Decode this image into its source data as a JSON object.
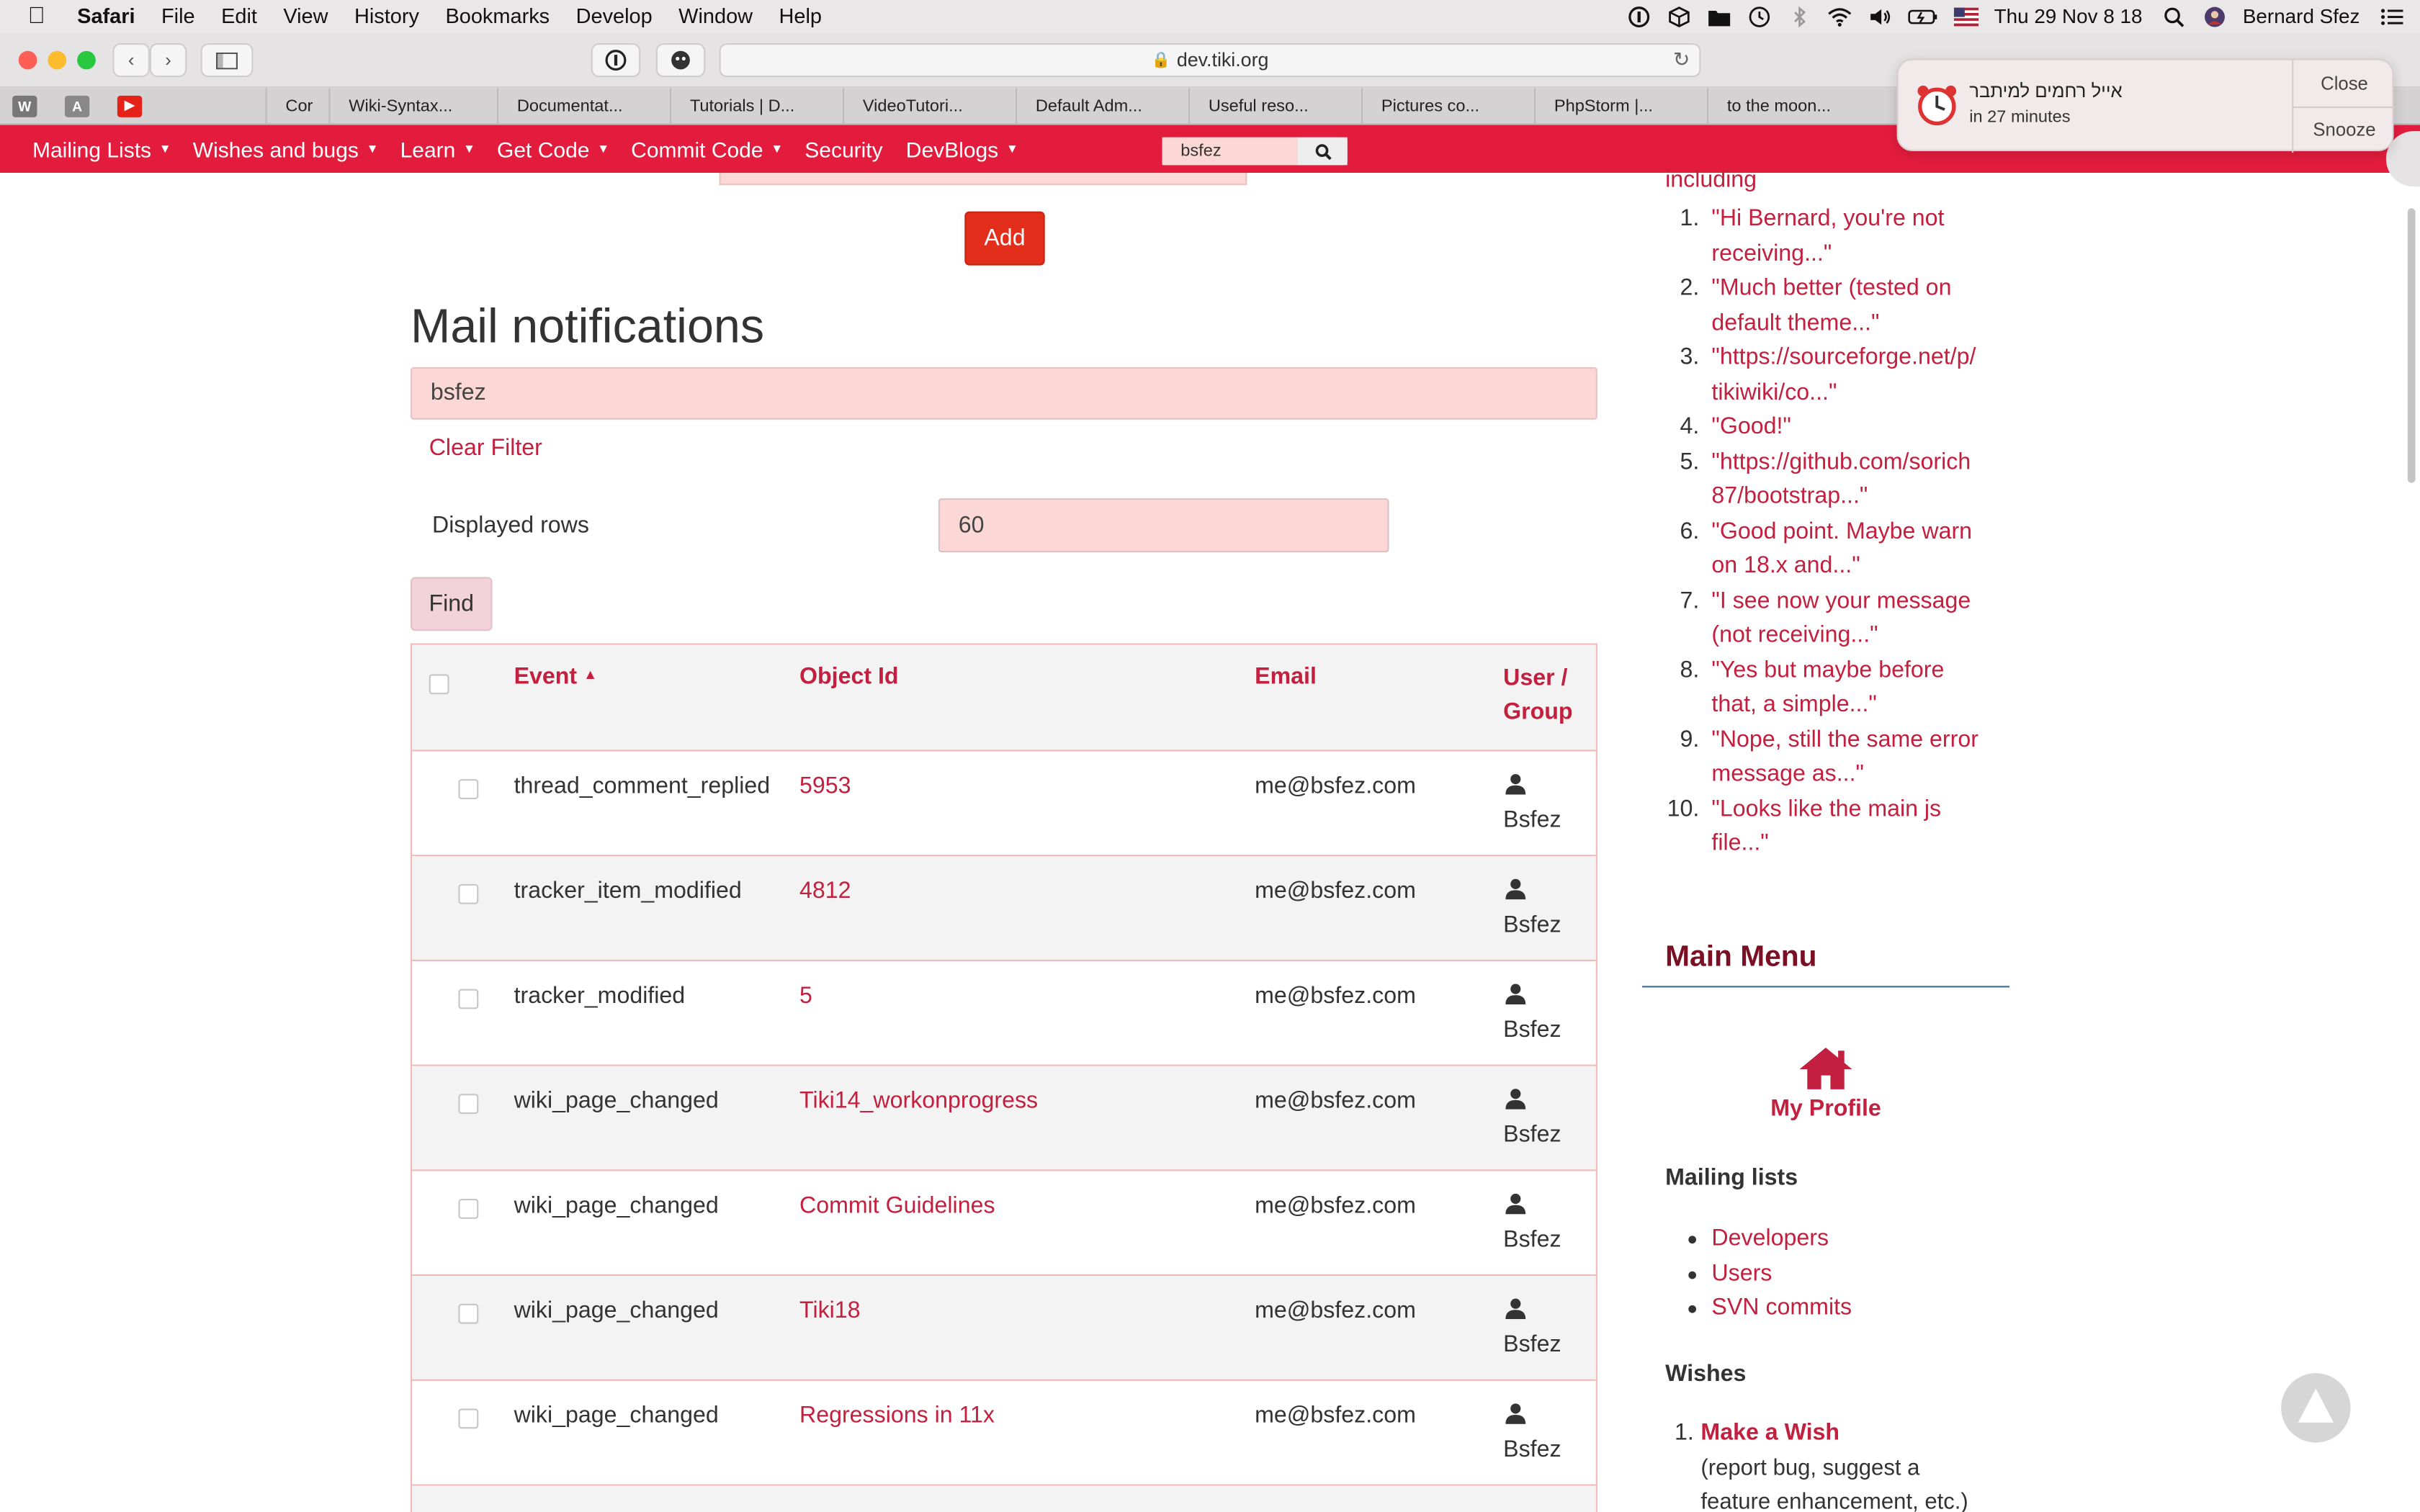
{
  "menubar": {
    "app": "Safari",
    "items": [
      "File",
      "Edit",
      "View",
      "History",
      "Bookmarks",
      "Develop",
      "Window",
      "Help"
    ],
    "datetime": "Thu 29 Nov  8 18",
    "user": "Bernard Sfez"
  },
  "browser": {
    "url": "dev.tiki.org",
    "tabs": [
      "Cor",
      "Wiki-Syntax...",
      "Documentat...",
      "Tutorials | D...",
      "VideoTutori...",
      "Default Adm...",
      "Useful reso...",
      "Pictures co...",
      "PhpStorm |...",
      "to the moon..."
    ],
    "favicons": [
      "W",
      "A"
    ]
  },
  "notification": {
    "title": "אייל רחמים למיתבר",
    "subtitle": "in 27 minutes",
    "close_label": "Close",
    "snooze_label": "Snooze"
  },
  "navbar": {
    "items": [
      "Mailing Lists",
      "Wishes and bugs",
      "Learn",
      "Get Code",
      "Commit Code",
      "Security",
      "DevBlogs"
    ],
    "search_value": "bsfez"
  },
  "main": {
    "add_label": "Add",
    "heading": "Mail notifications",
    "filter_value": "bsfez",
    "clear_filter": "Clear Filter",
    "rows_label": "Displayed rows",
    "rows_value": "60",
    "find_label": "Find",
    "columns": {
      "event": "Event",
      "object_id": "Object Id",
      "email": "Email",
      "user_group_1": "User /",
      "user_group_2": "Group"
    },
    "rows": [
      {
        "event": "thread_comment_replied",
        "object_id": "5953",
        "email": "me@bsfez.com",
        "user": "Bsfez"
      },
      {
        "event": "tracker_item_modified",
        "object_id": "4812",
        "email": "me@bsfez.com",
        "user": "Bsfez"
      },
      {
        "event": "tracker_modified",
        "object_id": "5",
        "email": "me@bsfez.com",
        "user": "Bsfez"
      },
      {
        "event": "wiki_page_changed",
        "object_id": "Tiki14_workonprogress",
        "email": "me@bsfez.com",
        "user": "Bsfez"
      },
      {
        "event": "wiki_page_changed",
        "object_id": "Commit Guidelines",
        "email": "me@bsfez.com",
        "user": "Bsfez"
      },
      {
        "event": "wiki_page_changed",
        "object_id": "Tiki18",
        "email": "me@bsfez.com",
        "user": "Bsfez"
      },
      {
        "event": "wiki_page_changed",
        "object_id": "Regressions in 11x",
        "email": "me@bsfez.com",
        "user": "Bsfez"
      }
    ]
  },
  "sidebar": {
    "including": "including",
    "comments": [
      [
        "\"Hi Bernard, you're not",
        "receiving...\""
      ],
      [
        "\"Much better (tested on",
        "default theme...\""
      ],
      [
        "\"https://sourceforge.net/p/",
        "tikiwiki/co...\""
      ],
      [
        "\"Good!\""
      ],
      [
        "\"https://github.com/sorich",
        "87/bootstrap...\""
      ],
      [
        "\"Good point. Maybe warn",
        "on 18.x and...\""
      ],
      [
        "\"I see now your message",
        "(not receiving...\""
      ],
      [
        "\"Yes but maybe before",
        "that, a simple...\""
      ],
      [
        "\"Nope, still the same error",
        "message as...\""
      ],
      [
        "\"Looks like the main js",
        "file...\""
      ]
    ],
    "main_menu": "Main Menu",
    "my_profile": "My Profile",
    "mailing_lists_heading": "Mailing lists",
    "mailing_lists": [
      "Developers",
      "Users",
      "SVN commits"
    ],
    "wishes_heading": "Wishes",
    "wish_item": "Make a Wish",
    "wish_desc_1": "(report bug, suggest a",
    "wish_desc_2": "feature enhancement, etc.)"
  },
  "colors": {
    "brand_red": "#e31c3d",
    "link_red": "#c3203f",
    "input_pink": "#fbd8d5"
  }
}
